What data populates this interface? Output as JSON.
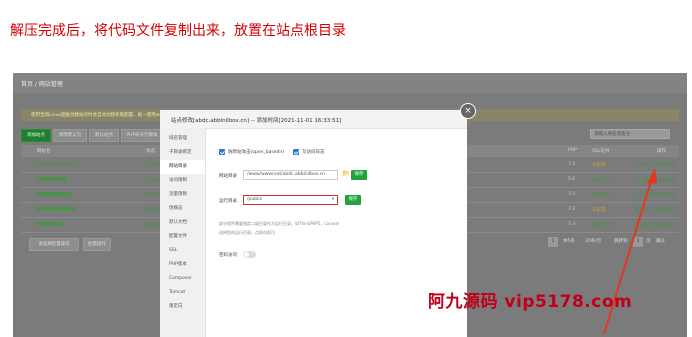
{
  "caption": "解压完成后，将代码文件复制出来，放置在站点根目录",
  "breadcrumb": "首页 / 网站管理",
  "notice": "使用宝塔Linux面板创建站点时会自动创建权限配置，统一使用www用户，建议使用 申请SSL证书 可提高网站安全性",
  "toolbar": {
    "add_site": "添加站点",
    "modify_default_page": "修改默认页",
    "default_site": "默认站点",
    "php_cli": "PHP命令行版本",
    "category": "分类管理",
    "search_placeholder": "请输入域名或备注"
  },
  "table": {
    "headers": {
      "name": "网站名",
      "status": "状态",
      "php": "PHP",
      "ssl": "SSL证书",
      "actions": "操作"
    },
    "rows": [
      {
        "name": "abdc.abblnilbox.cn",
        "status": "运行中▶",
        "php": "7.3",
        "ssl": "未部署",
        "actions": "防火墙 | 设置 | 删除"
      },
      {
        "name": "■■■■■■■",
        "status": "运行中▶",
        "php": "5.6",
        "ssl": "剩余35天",
        "actions": "防火墙 | 设置 | 删除"
      },
      {
        "name": "■■■■■■■■",
        "status": "运行中▶",
        "php": "7.3",
        "ssl": "剩余49天",
        "actions": "防火墙 | 设置 | 删除"
      },
      {
        "name": "■■■■■■■■■",
        "status": "运行中▶",
        "php": "7.3",
        "ssl": "未部署",
        "actions": "防火墙 | 设置 | 删除"
      },
      {
        "name": "■■■■■■",
        "status": "运行中▶",
        "php": "7.3",
        "ssl": "剩余71天",
        "actions": "防火墙 | 设置 | 删除"
      }
    ]
  },
  "footer": {
    "batch": "请选择批量操作",
    "exec": "批量操作"
  },
  "pager": {
    "page": "1",
    "total": "共5条",
    "per_page": "20条/页",
    "goto": "跳转到",
    "page_unit": "页",
    "confirm": "确认"
  },
  "modal": {
    "title": "站点修改[abdc.abblnilbox.cn] -- 添加时间[2021-11-01 16:33:51]",
    "close": "×",
    "menu": [
      "域名管理",
      "子目录绑定",
      "网站目录",
      "访问限制",
      "流量限制",
      "伪静态",
      "默认文档",
      "配置文件",
      "SSL",
      "PHP版本",
      "Composer",
      "Tomcat",
      "重定向"
    ],
    "active_index": 2,
    "anti_xss": "防跨站攻击(open_basedir)",
    "write_log": "写访问日志",
    "site_dir_label": "网站目录",
    "site_dir_value": "/www/wwwroot/abdc.abblnilbox.cn",
    "save": "保存",
    "run_dir_label": "运行目录",
    "run_dir_value": "/public",
    "run_save": "保存",
    "tip1": "部分程序需要指定二级目录作为运行目录，如ThinkPHP5，Laravel",
    "tip2": "选择您的运行目录，点保存即可",
    "password_access": "密码访问"
  },
  "watermark": "阿九源码  vip5178.com",
  "colors": {
    "caption": "#d40000",
    "accent_green": "#20a53a",
    "watermark": "#c0001a",
    "arrow": "#e8341c"
  }
}
